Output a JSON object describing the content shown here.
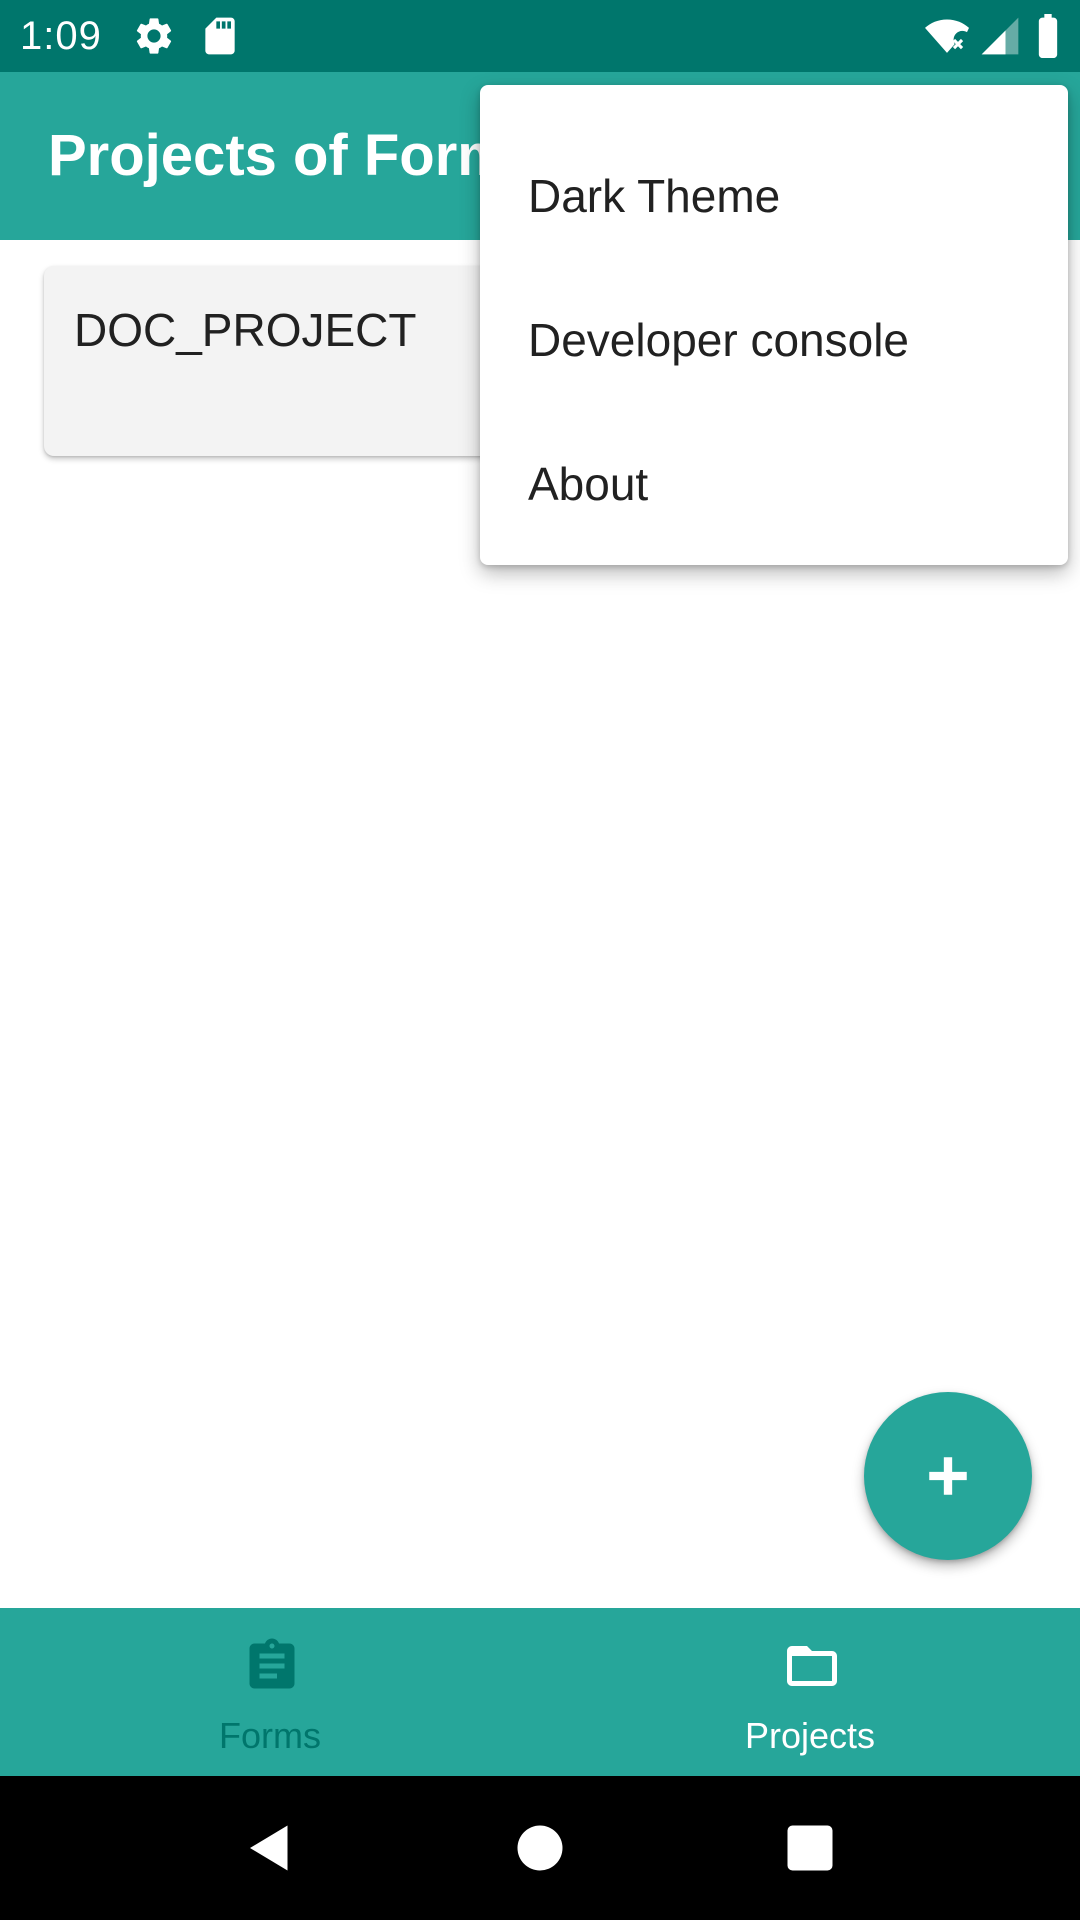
{
  "status_bar": {
    "time": "1:09",
    "icons": [
      "settings-icon",
      "sd-card-icon",
      "wifi-off-icon",
      "signal-icon",
      "battery-icon"
    ]
  },
  "app_bar": {
    "title": "Projects of Forms"
  },
  "project_list": [
    {
      "name": "DOC_PROJECT"
    }
  ],
  "overflow_menu": {
    "items": [
      {
        "label": "Dark Theme"
      },
      {
        "label": "Developer console"
      },
      {
        "label": "About"
      }
    ]
  },
  "fab": {
    "icon": "plus-icon"
  },
  "bottom_nav": {
    "items": [
      {
        "label": "Forms",
        "icon": "clipboard-icon",
        "active": false
      },
      {
        "label": "Projects",
        "icon": "folder-icon",
        "active": true
      }
    ]
  },
  "system_nav": {
    "buttons": [
      "back-icon",
      "home-icon",
      "recents-icon"
    ]
  },
  "colors": {
    "primary": "#26a69a",
    "primary_dark": "#00766c",
    "card_background": "#f3f3f3",
    "text_primary": "#212121",
    "on_primary": "#ffffff"
  }
}
